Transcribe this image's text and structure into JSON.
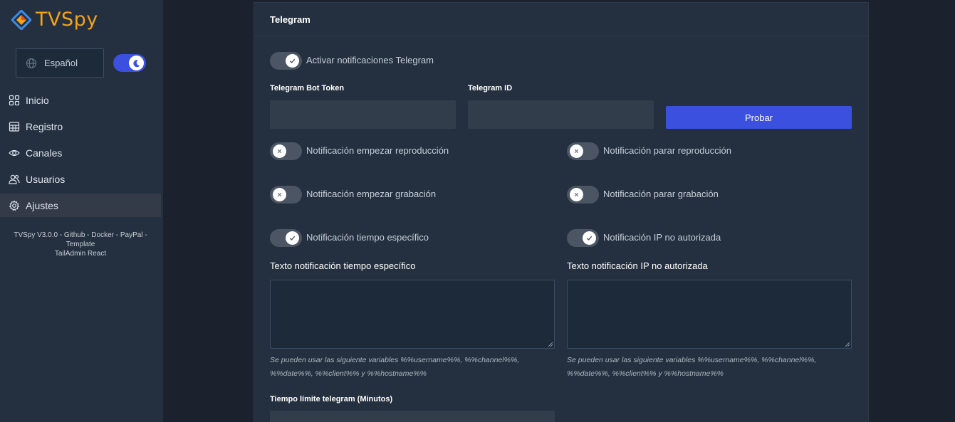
{
  "app": {
    "logo_text": "TVSpy",
    "brand_color": "#f3a21a",
    "accent_color": "#3c50e0"
  },
  "sidebar": {
    "language": "Español",
    "dark_mode": true,
    "items": [
      {
        "label": "Inicio",
        "icon": "grid-icon"
      },
      {
        "label": "Registro",
        "icon": "table-icon"
      },
      {
        "label": "Canales",
        "icon": "eye-icon"
      },
      {
        "label": "Usuarios",
        "icon": "users-icon"
      },
      {
        "label": "Ajustes",
        "icon": "gear-icon",
        "active": true
      }
    ],
    "footer_line1": "TVSpy V3.0.0 - Github - Docker - PayPal - Template",
    "footer_line2": "TailAdmin React"
  },
  "telegram": {
    "title": "Telegram",
    "enable": {
      "label": "Activar notificaciones Telegram",
      "on": true
    },
    "bot_token": {
      "label": "Telegram Bot Token",
      "value": ""
    },
    "telegram_id": {
      "label": "Telegram ID",
      "value": ""
    },
    "test_button": "Probar",
    "toggles": {
      "start_playback": {
        "label": "Notificación empezar reproducción",
        "on": false
      },
      "stop_playback": {
        "label": "Notificación parar reproducción",
        "on": false
      },
      "start_recording": {
        "label": "Notificación empezar grabación",
        "on": false
      },
      "stop_recording": {
        "label": "Notificación parar grabación",
        "on": false
      },
      "specific_time": {
        "label": "Notificación tiempo específico",
        "on": true
      },
      "unauthorized_ip": {
        "label": "Notificación IP no autorizada",
        "on": true
      }
    },
    "text_specific_time": {
      "label": "Texto notificación tiempo específico",
      "value": "",
      "hint_line1": "Se pueden usar las siguiente variables %%username%%, %%channel%%,",
      "hint_line2": "%%date%%, %%client%% y %%hostname%%"
    },
    "text_unauthorized_ip": {
      "label": "Texto notificación IP no autorizada",
      "value": "",
      "hint_line1": "Se pueden usar las siguiente variables %%username%%, %%channel%%,",
      "hint_line2": "%%date%%, %%client%% y %%hostname%%"
    },
    "time_limit": {
      "label": "Tiempo límite telegram (Minutos)",
      "value": ""
    }
  }
}
